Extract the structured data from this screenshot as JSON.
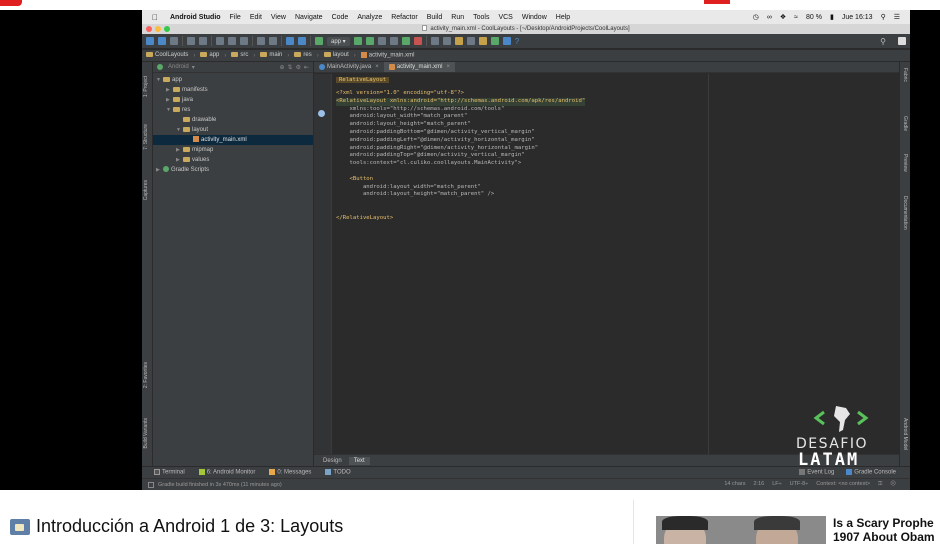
{
  "mac_menu": {
    "app_name": "Android Studio",
    "items": [
      "File",
      "Edit",
      "View",
      "Navigate",
      "Code",
      "Analyze",
      "Refactor",
      "Build",
      "Run",
      "Tools",
      "VCS",
      "Window",
      "Help"
    ],
    "battery": "80 %",
    "clock": "Jue 16:13"
  },
  "window": {
    "title": "activity_main.xml - CoolLayouts - [~/Desktop/AndroidProjects/CoolLayouts]"
  },
  "toolbar": {
    "run_config": "app",
    "help": "?"
  },
  "breadcrumb": [
    "CoolLayouts",
    "app",
    "src",
    "main",
    "res",
    "layout",
    "activity_main.xml"
  ],
  "side_tools": {
    "left": [
      "1: Project",
      "7: Structure",
      "Captures",
      "2: Favorites",
      "Build Variants"
    ],
    "right": [
      "Gradle",
      "Preview",
      "Documentation",
      "Android Model"
    ],
    "right_top": "Fabric"
  },
  "project_panel": {
    "view": "Android",
    "tree": [
      {
        "label": "app",
        "indent": 0,
        "twisty": "▼",
        "kind": "folder"
      },
      {
        "label": "manifests",
        "indent": 1,
        "twisty": "▶",
        "kind": "folder"
      },
      {
        "label": "java",
        "indent": 1,
        "twisty": "▶",
        "kind": "folder"
      },
      {
        "label": "res",
        "indent": 1,
        "twisty": "▼",
        "kind": "folder"
      },
      {
        "label": "drawable",
        "indent": 2,
        "twisty": "",
        "kind": "folder"
      },
      {
        "label": "layout",
        "indent": 2,
        "twisty": "▼",
        "kind": "folder"
      },
      {
        "label": "activity_main.xml",
        "indent": 3,
        "twisty": "",
        "kind": "file",
        "selected": true
      },
      {
        "label": "mipmap",
        "indent": 2,
        "twisty": "▶",
        "kind": "folder"
      },
      {
        "label": "values",
        "indent": 2,
        "twisty": "▶",
        "kind": "folder"
      },
      {
        "label": "Gradle Scripts",
        "indent": 0,
        "twisty": "▶",
        "kind": "gradle"
      }
    ]
  },
  "editor": {
    "tabs": [
      {
        "label": "MainActivity.java",
        "active": false
      },
      {
        "label": "activity_main.xml",
        "active": true
      }
    ],
    "breadcrumb_tag": "RelativeLayout",
    "code": [
      "<?xml version=\"1.0\" encoding=\"utf-8\"?>",
      "<RelativeLayout xmlns:android=\"http://schemas.android.com/apk/res/android\"",
      "    xmlns:tools=\"http://schemas.android.com/tools\"",
      "    android:layout_width=\"match_parent\"",
      "    android:layout_height=\"match_parent\"",
      "    android:paddingBottom=\"@dimen/activity_vertical_margin\"",
      "    android:paddingLeft=\"@dimen/activity_horizontal_margin\"",
      "    android:paddingRight=\"@dimen/activity_horizontal_margin\"",
      "    android:paddingTop=\"@dimen/activity_vertical_margin\"",
      "    tools:context=\"cl.culiko.coollayouts.MainActivity\">",
      "",
      "    <Button",
      "        android:layout_width=\"match_parent\"",
      "        android:layout_height=\"match_parent\" />",
      "",
      "",
      "</RelativeLayout>"
    ],
    "bottom_tabs": [
      "Design",
      "Text"
    ],
    "active_bottom_tab": "Text"
  },
  "tool_windows": {
    "left": [
      {
        "label": "Terminal"
      },
      {
        "label": "6: Android Monitor"
      },
      {
        "label": "0: Messages"
      },
      {
        "label": "TODO"
      }
    ],
    "right": [
      {
        "label": "Event Log"
      },
      {
        "label": "Gradle Console"
      }
    ]
  },
  "status": {
    "message": "Gradle build finished in 3s 470ms (11 minutes ago)",
    "chars": "14 chars",
    "position": "2:16",
    "line_sep": "LF÷",
    "encoding": "UTF-8÷",
    "context": "Context: <no context>"
  },
  "watermark": {
    "line1": "DESAFIO",
    "line2": "LATAM"
  },
  "video_title": "Introducción a Android 1 de 3: Layouts",
  "related": {
    "title_line1": "Is a Scary Prophe",
    "title_line2": "1907 About Obam"
  }
}
